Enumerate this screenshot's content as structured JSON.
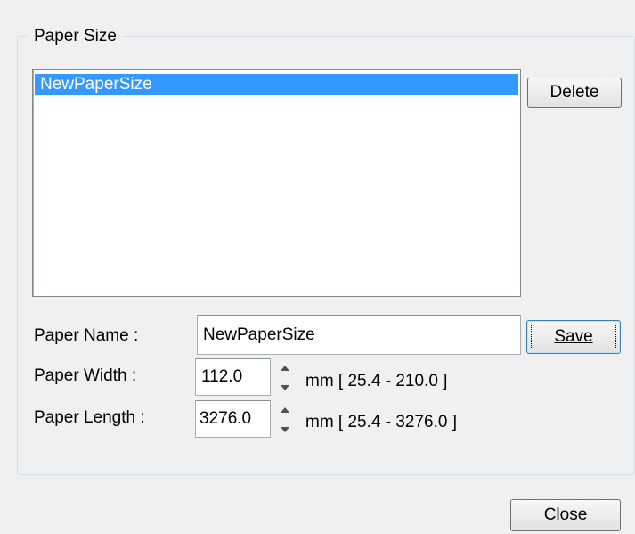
{
  "group": {
    "title": "Paper Size"
  },
  "paper_list": {
    "items": [
      "NewPaperSize"
    ],
    "selected": "NewPaperSize"
  },
  "buttons": {
    "delete": "Delete",
    "save": "Save",
    "close": "Close"
  },
  "fields": {
    "name_label": "Paper Name :",
    "name_value": "NewPaperSize",
    "width_label": "Paper Width :",
    "width_value": "112.0",
    "width_range": "mm [ 25.4 - 210.0 ]",
    "length_label": "Paper Length :",
    "length_value": "3276.0",
    "length_range": "mm [ 25.4 - 3276.0 ]"
  },
  "colors": {
    "selection": "#3399ff",
    "window_bg": "#f0f0f0"
  },
  "icons": {
    "spinner_up": "triangle-up-icon",
    "spinner_down": "triangle-down-icon"
  }
}
